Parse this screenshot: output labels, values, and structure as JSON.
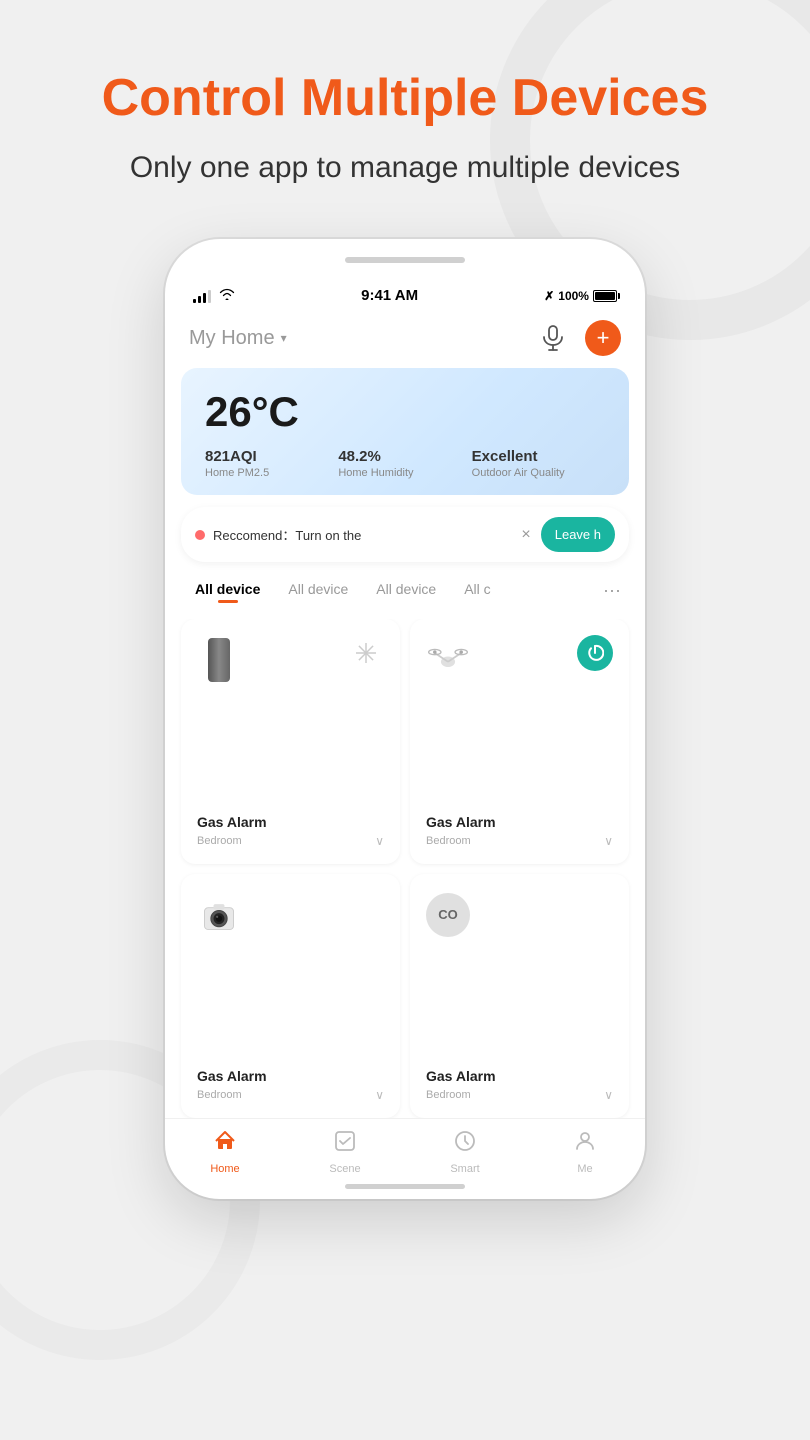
{
  "page": {
    "background_color": "#f0f0f0"
  },
  "heading": {
    "main_title": "Control Multiple Devices",
    "sub_title": "Only one app to manage multiple devices"
  },
  "status_bar": {
    "time": "9:41 AM",
    "battery_percent": "100%",
    "signal_strength": "3",
    "bluetooth_label": "Bluetooth"
  },
  "app_header": {
    "home_name": "My Home",
    "chevron": "▾",
    "mic_label": "microphone",
    "add_label": "+"
  },
  "weather_card": {
    "temperature": "26°C",
    "pm25_value": "821AQI",
    "pm25_label": "Home PM2.5",
    "humidity_value": "48.2%",
    "humidity_label": "Home Humidity",
    "air_quality_value": "Excellent",
    "air_quality_label": "Outdoor Air Quality"
  },
  "recommend_banner": {
    "text": "Reccomend：Turn on the",
    "close_icon": "×",
    "action_label": "Leave h"
  },
  "tabs": [
    {
      "label": "All device",
      "active": true
    },
    {
      "label": "All device",
      "active": false
    },
    {
      "label": "All device",
      "active": false
    },
    {
      "label": "All c",
      "active": false
    }
  ],
  "tab_more": "···",
  "devices": [
    {
      "name": "Gas Alarm",
      "room": "Bedroom",
      "icon_type": "gas_alarm",
      "action_type": "fan",
      "power_on": false
    },
    {
      "name": "Gas Alarm",
      "room": "Bedroom",
      "icon_type": "drone",
      "action_type": "power",
      "power_on": true
    },
    {
      "name": "Gas Alarm",
      "room": "Bedroom",
      "icon_type": "camera",
      "action_type": "none",
      "power_on": false
    },
    {
      "name": "Gas Alarm",
      "room": "Bedroom",
      "icon_type": "co_detector",
      "action_type": "none",
      "power_on": false
    }
  ],
  "bottom_nav": [
    {
      "label": "Home",
      "icon": "🏠",
      "active": true
    },
    {
      "label": "Scene",
      "icon": "☑",
      "active": false
    },
    {
      "label": "Smart",
      "icon": "⏱",
      "active": false
    },
    {
      "label": "Me",
      "icon": "👤",
      "active": false
    }
  ]
}
